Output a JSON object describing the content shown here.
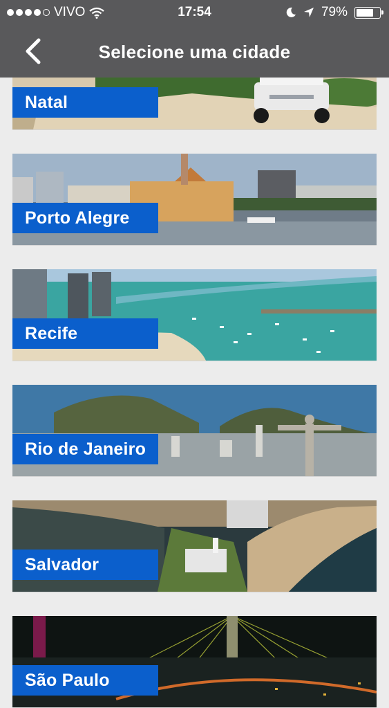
{
  "status_bar": {
    "carrier": "VIVO",
    "time": "17:54",
    "battery": "79%",
    "battery_level": 0.79
  },
  "header": {
    "title": "Selecione uma cidade",
    "back_icon": "chevron-left-icon"
  },
  "cities": [
    {
      "name": "Natal"
    },
    {
      "name": "Porto Alegre"
    },
    {
      "name": "Recife"
    },
    {
      "name": "Rio de Janeiro"
    },
    {
      "name": "Salvador"
    },
    {
      "name": "São Paulo"
    }
  ],
  "colors": {
    "header_bg": "#59595b",
    "label_bg": "#0b5fcc",
    "page_bg": "#ececec"
  }
}
